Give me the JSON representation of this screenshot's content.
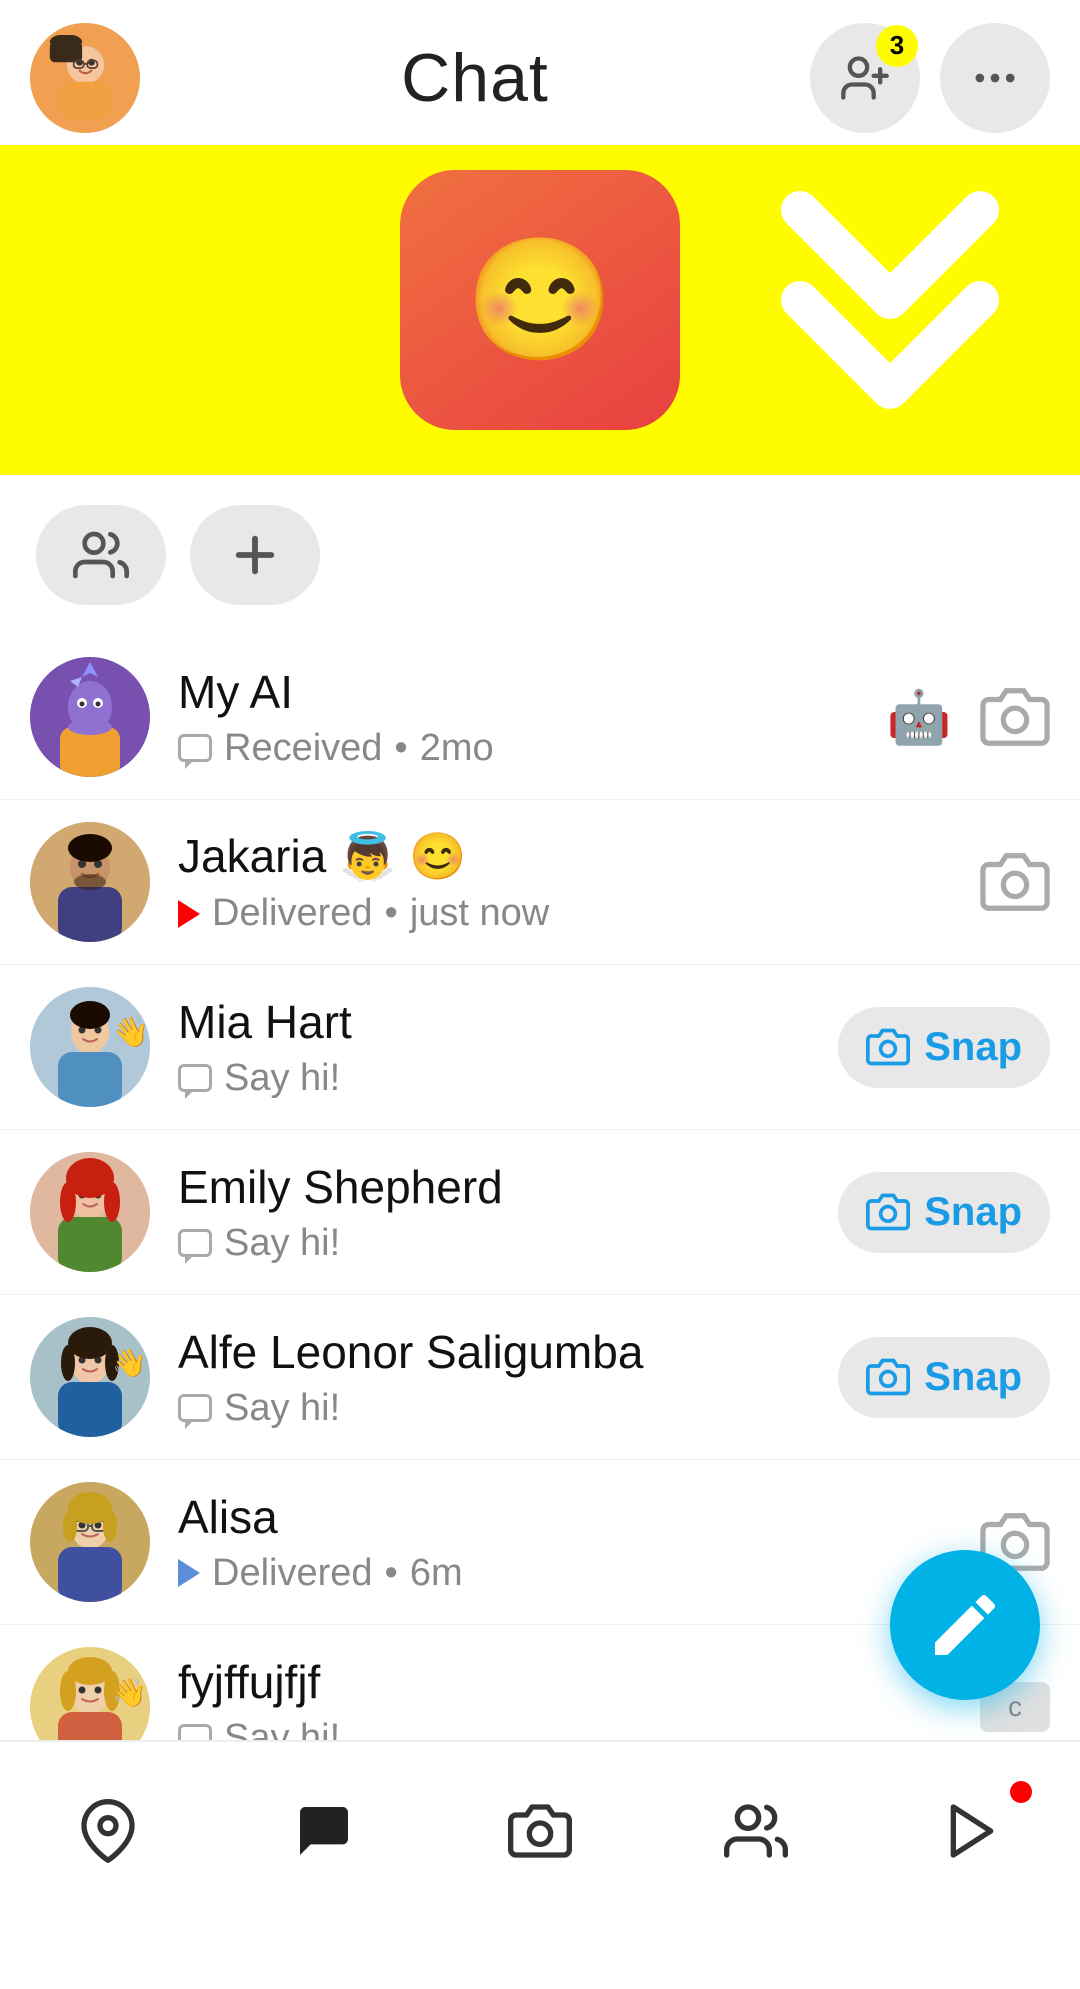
{
  "header": {
    "title": "Chat",
    "badge_count": "3"
  },
  "quick_actions": [
    {
      "id": "new-group",
      "label": "New Group"
    },
    {
      "id": "add-friend",
      "label": "Add Friend"
    }
  ],
  "chat_list": [
    {
      "id": "my-ai",
      "name": "My AI",
      "status_text": "Received",
      "status_time": "2mo",
      "status_type": "received",
      "has_snap_btn": false,
      "has_robot": true,
      "has_camera": true
    },
    {
      "id": "jakaria",
      "name": "Jakaria 👼 😊",
      "status_text": "Delivered",
      "status_time": "just now",
      "status_type": "delivered",
      "has_snap_btn": false,
      "has_robot": false,
      "has_camera": true
    },
    {
      "id": "mia-hart",
      "name": "Mia Hart",
      "status_text": "Say hi!",
      "status_type": "sayhil",
      "has_snap_btn": true,
      "snap_label": "Snap"
    },
    {
      "id": "emily-shepherd",
      "name": "Emily Shepherd",
      "status_text": "Say hi!",
      "status_type": "sayhi",
      "has_snap_btn": true,
      "snap_label": "Snap"
    },
    {
      "id": "alfe-leonor",
      "name": "Alfe Leonor Saligumba",
      "status_text": "Say hi!",
      "status_type": "sayhi",
      "has_snap_btn": true,
      "snap_label": "Snap"
    },
    {
      "id": "alisa",
      "name": "Alisa",
      "status_text": "Delivered",
      "status_time": "6m",
      "status_type": "sent",
      "has_snap_btn": false,
      "has_robot": false,
      "has_camera": true
    },
    {
      "id": "fyjffujfjf",
      "name": "fyjffujfjf",
      "status_text": "Say hi!",
      "status_type": "sayhi",
      "has_snap_btn": false,
      "has_robot": true,
      "has_camera": false
    }
  ],
  "bottom_nav": [
    {
      "id": "map",
      "icon": "map-icon"
    },
    {
      "id": "chat",
      "icon": "chat-icon",
      "active": true
    },
    {
      "id": "camera",
      "icon": "camera-icon"
    },
    {
      "id": "friends",
      "icon": "friends-icon"
    },
    {
      "id": "stories",
      "icon": "stories-icon",
      "has_dot": true
    }
  ],
  "fab": {
    "icon": "compose-icon",
    "label": "New Chat"
  }
}
